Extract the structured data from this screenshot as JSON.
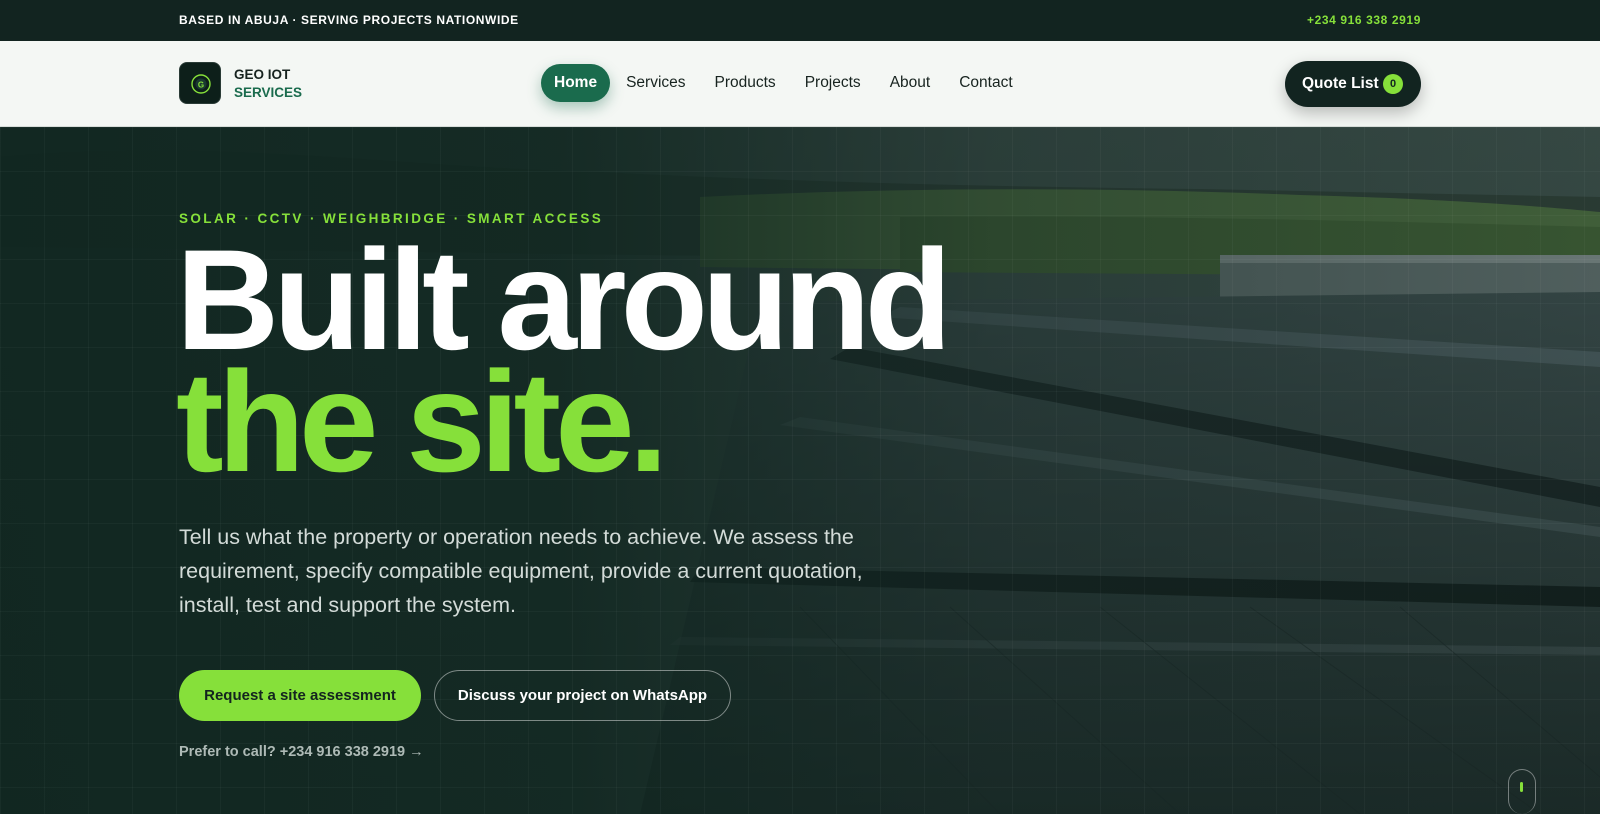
{
  "topbar": {
    "left_text": "BASED IN ABUJA · SERVING PROJECTS NATIONWIDE",
    "phone": "+234 916 338 2919"
  },
  "header": {
    "brand_line1": "GEO IOT",
    "brand_line2": "SERVICES",
    "nav": [
      {
        "label": "Home",
        "active": true
      },
      {
        "label": "Services"
      },
      {
        "label": "Products"
      },
      {
        "label": "Projects"
      },
      {
        "label": "About"
      },
      {
        "label": "Contact"
      }
    ],
    "quote_label": "Quote List",
    "quote_count": "0"
  },
  "hero": {
    "eyebrow": "SOLAR · CCTV · WEIGHBRIDGE · SMART ACCESS",
    "title_line1": "Built around",
    "title_line2": "the site.",
    "lead": "Tell us what the property or operation needs to achieve. We assess the requirement, specify compatible equipment, provide a current quotation, install, test and support the system.",
    "primary_cta": "Request a site assessment",
    "secondary_cta": "Discuss your project on WhatsApp",
    "call_text": "Prefer to call? +234 916 338 2919 →"
  },
  "colors": {
    "accent": "#86e03a",
    "brand_green": "#1a6b4d",
    "dark": "#122420"
  }
}
